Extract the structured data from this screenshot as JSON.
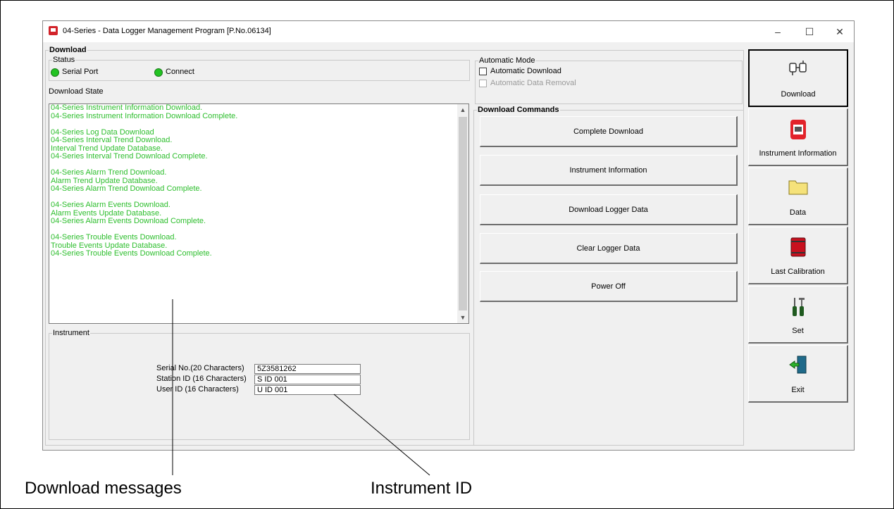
{
  "window": {
    "title": "04-Series - Data Logger Management Program [P.No.06134]",
    "minimize_glyph": "–",
    "maximize_glyph": "☐",
    "close_glyph": "✕"
  },
  "download": {
    "group_label": "Download",
    "status": {
      "label": "Status",
      "serial_port": "Serial Port",
      "connect": "Connect",
      "indicator_color": "#22c322"
    },
    "state_label": "Download State",
    "messages": [
      "04-Series Instrument Information Download.",
      "04-Series Instrument Information Download Complete.",
      "",
      "04-Series Log Data Download",
      "04-Series Interval Trend Download.",
      "Interval Trend Update Database.",
      "04-Series Interval Trend Download Complete.",
      "",
      "04-Series Alarm Trend Download.",
      "Alarm Trend Update Database.",
      "04-Series Alarm Trend Download Complete.",
      "",
      "04-Series Alarm Events Download.",
      "Alarm Events Update Database.",
      "04-Series Alarm Events Download Complete.",
      "",
      "04-Series Trouble Events Download.",
      "Trouble Events Update Database.",
      "04-Series Trouble Events Download Complete."
    ],
    "message_color": "#2dbe2d"
  },
  "instrument": {
    "group_label": "Instrument",
    "serial_label": "Serial No.(20 Characters)",
    "serial_value": "5Z3581262",
    "station_label": "Station ID (16 Characters)",
    "station_value": "S  ID  001",
    "user_label": "User ID (16 Characters)",
    "user_value": "U  ID  001"
  },
  "automatic_mode": {
    "label": "Automatic Mode",
    "auto_download": "Automatic Download",
    "auto_removal": "Automatic Data Removal"
  },
  "commands": {
    "label": "Download Commands",
    "buttons": [
      "Complete Download",
      "Instrument Information",
      "Download Logger Data",
      "Clear Logger Data",
      "Power Off"
    ]
  },
  "sidebar": {
    "buttons": [
      {
        "label": "Download",
        "icon": "connector-plugs-icon"
      },
      {
        "label": "Instrument Information",
        "icon": "instrument-icon"
      },
      {
        "label": "Data",
        "icon": "folder-icon"
      },
      {
        "label": "Last Calibration",
        "icon": "book-icon"
      },
      {
        "label": "Set",
        "icon": "tools-icon"
      },
      {
        "label": "Exit",
        "icon": "exit-door-icon"
      }
    ]
  },
  "callouts": {
    "download_messages": "Download messages",
    "instrument_id": "Instrument ID"
  }
}
